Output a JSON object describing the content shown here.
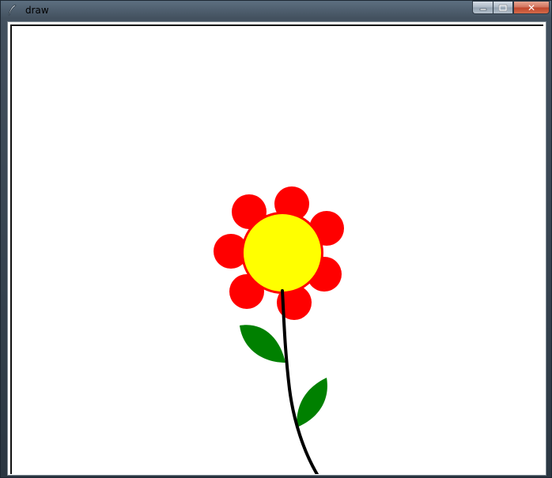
{
  "window": {
    "title": "draw",
    "icon": "feather-icon",
    "controls": {
      "minimize": "minimize-icon",
      "maximize": "maximize-icon",
      "close": "✕"
    }
  },
  "colors": {
    "petals": "#ff0000",
    "center": "#ffff00",
    "stem": "#000000",
    "leaves": "#008000",
    "canvas": "#ffffff"
  }
}
